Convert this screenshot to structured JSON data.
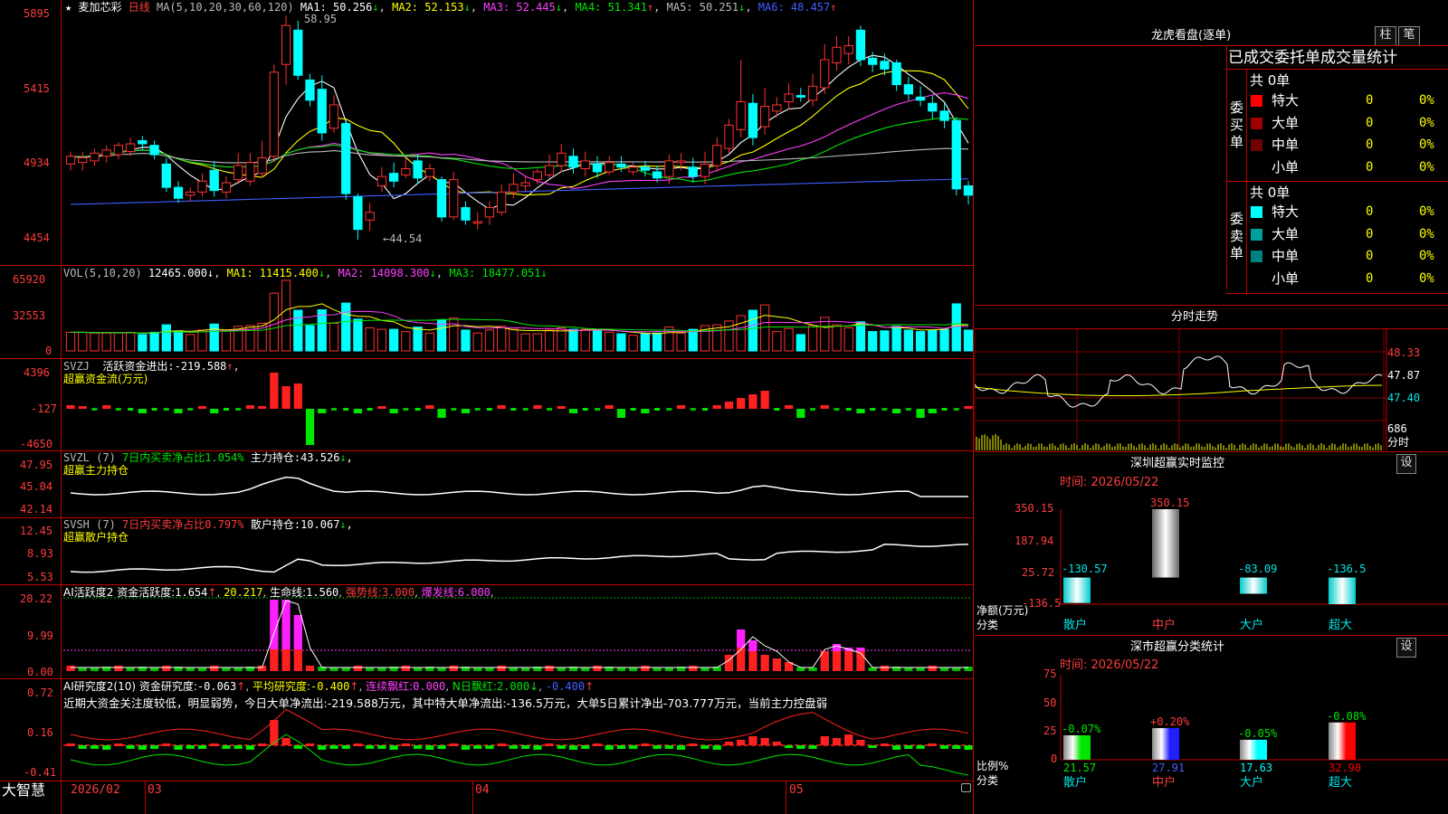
{
  "stock": {
    "star": "★",
    "name": "麦加芯彩",
    "period": "日线"
  },
  "kline": {
    "ma_title": "MA(5,10,20,30,60,120)",
    "ma": [
      {
        "label": "MA1:",
        "value": "50.256",
        "arrow": "↓",
        "color": "#ffffff"
      },
      {
        "label": "MA2:",
        "value": "52.153",
        "arrow": "↓",
        "color": "#ffff00"
      },
      {
        "label": "MA3:",
        "value": "52.445",
        "arrow": "↓",
        "color": "#ff40ff"
      },
      {
        "label": "MA4:",
        "value": "51.341",
        "arrow": "↑",
        "color": "#00e600"
      },
      {
        "label": "MA5:",
        "value": "50.251",
        "arrow": "↓",
        "color": "#bbbbbb"
      },
      {
        "label": "MA6:",
        "value": "48.457",
        "arrow": "↑",
        "color": "#4060ff"
      }
    ],
    "y_ticks": [
      "5895",
      "5415",
      "4934",
      "4454"
    ],
    "high_label": "58.95",
    "low_label": "←44.54"
  },
  "vol": {
    "title": "VOL(5,10,20)",
    "value": "12465.000",
    "value_arrow": "↓",
    "ma": [
      {
        "label": "MA1:",
        "value": "11415.400",
        "arrow": "↓",
        "color": "#ffff00"
      },
      {
        "label": "MA2:",
        "value": "14098.300",
        "arrow": "↓",
        "color": "#ff40ff"
      },
      {
        "label": "MA3:",
        "value": "18477.051",
        "arrow": "↓",
        "color": "#00e600"
      }
    ],
    "y_ticks": [
      "65920",
      "32553",
      "0"
    ]
  },
  "svzj": {
    "title": "SVZJ",
    "label": "活跃资金进出:",
    "value": "-219.588",
    "arrow": "↑",
    "subtitle": "超赢资金流(万元)",
    "y_ticks": [
      "4396",
      "-127",
      "-4650"
    ]
  },
  "svzl": {
    "title": "SVZL (7)",
    "ratio": "7日内买卖净占比1.054%",
    "label": "主力持仓:",
    "value": "43.526",
    "arrow": "↓",
    "sep": ",",
    "subtitle": "超赢主力持仓",
    "y_ticks": [
      "47.95",
      "45.04",
      "42.14"
    ]
  },
  "svsh": {
    "title": "SVSH (7)",
    "ratio": "7日内买卖净占比0.797%",
    "label": "散户持仓:",
    "value": "10.067",
    "arrow": "↓",
    "sep": ",",
    "subtitle": "超赢散户持仓",
    "y_ticks": [
      "12.45",
      "8.93",
      "5.53"
    ]
  },
  "ai_active": {
    "title": "AI活跃度2",
    "label1": "资金活跃度:",
    "value1": "1.654",
    "arrow1": "↑",
    "value2": "20.217",
    "label3": "生命线:",
    "value3": "1.560",
    "label4": "强势线:",
    "value4": "3.000",
    "label5": "爆发线:",
    "value5": "6.000",
    "y_ticks": [
      "20.22",
      "9.99",
      "0.00"
    ]
  },
  "ai_research": {
    "title": "AI研究度2(10)",
    "label1": "资金研究度:",
    "value1": "-0.063",
    "arrow1": "↑",
    "label2": "平均研究度:",
    "value2": "-0.400",
    "arrow2": "↑",
    "label3": "连续飘红:",
    "value3": "0.000",
    "label4": "N日飘红:",
    "value4": "2.000",
    "arrow4": "↓",
    "value5": "-0.400",
    "arrow5": "↑",
    "comment": "近期大资金关注度较低，明显弱势，今日大单净流出:-219.588万元，其中特大单净流出:-136.5万元，大单5日累计净出-703.777万元，当前主力控盘弱",
    "y_ticks": [
      "0.72",
      "0.16",
      "-0.41"
    ]
  },
  "timeline": {
    "brand": "大智慧",
    "labels": [
      "2026/02",
      "03",
      "04",
      "05"
    ]
  },
  "dragon": {
    "title": "龙虎看盘(逐单)",
    "btn1": "柱",
    "btn2": "笔",
    "header": "已成交委托单成交量统计",
    "buy_side": "委买单",
    "sell_side": "委卖单",
    "buy_total": "共 0单",
    "sell_total": "共 0单",
    "buy_rows": [
      {
        "label": "特大",
        "count": "0",
        "pct": "0%",
        "color": "#ff0000"
      },
      {
        "label": "大单",
        "count": "0",
        "pct": "0%",
        "color": "#a00000"
      },
      {
        "label": "中单",
        "count": "0",
        "pct": "0%",
        "color": "#700000"
      },
      {
        "label": "小单",
        "count": "0",
        "pct": "0%",
        "color": ""
      }
    ],
    "sell_rows": [
      {
        "label": "特大",
        "count": "0",
        "pct": "0%",
        "color": "#00ffff"
      },
      {
        "label": "大单",
        "count": "0",
        "pct": "0%",
        "color": "#00a0a0"
      },
      {
        "label": "中单",
        "count": "0",
        "pct": "0%",
        "color": "#008080"
      },
      {
        "label": "小单",
        "count": "0",
        "pct": "0%",
        "color": ""
      }
    ]
  },
  "intraday": {
    "title": "分时走势",
    "prices": [
      "48.33",
      "47.87",
      "47.40"
    ],
    "vol": "686",
    "vol_unit": "分时"
  },
  "sz_monitor": {
    "title": "深圳超赢实时监控",
    "set": "设",
    "time": "时间: 2026/05/22",
    "y_ticks": [
      "350.15",
      "187.94",
      "25.72",
      "-136.5"
    ],
    "ylabel1": "净额(万元)",
    "ylabel2": "分类",
    "categories": [
      "散户",
      "中户",
      "大户",
      "超大"
    ],
    "values": [
      "-130.57",
      "350.15",
      "-83.09",
      "-136.5"
    ]
  },
  "sz_class": {
    "title": "深市超赢分类统计",
    "set": "设",
    "time": "时间: 2026/05/22",
    "y_ticks": [
      "75",
      "50",
      "25",
      "0"
    ],
    "ylabel1": "比例%",
    "ylabel2": "分类",
    "categories": [
      "散户",
      "中户",
      "大户",
      "超大"
    ],
    "changes": [
      "-0.07%",
      "+0.20%",
      "-0.05%",
      "-0.08%"
    ],
    "values": [
      "21.57",
      "27.91",
      "17.63",
      "32.90"
    ],
    "colors": [
      "#00e600",
      "#2020ff",
      "#00ffff",
      "#ff0000"
    ]
  },
  "chart_data": [
    {
      "type": "candlestick",
      "title": "麦加芯彩 日线",
      "ylim": [
        44.54,
        58.95
      ],
      "x_labels": [
        "2026/02",
        "03",
        "04",
        "05"
      ],
      "candles": [
        [
          49.4,
          49.9,
          49.0,
          50.2
        ],
        [
          49.5,
          49.8,
          49.0,
          50.2
        ],
        [
          49.6,
          50.1,
          49.3,
          50.4
        ],
        [
          49.9,
          50.3,
          49.5,
          50.6
        ],
        [
          50.0,
          50.6,
          49.7,
          50.8
        ],
        [
          50.2,
          50.7,
          49.9,
          51.1
        ],
        [
          50.9,
          50.7,
          50.3,
          51.2
        ],
        [
          50.6,
          50.0,
          49.7,
          50.9
        ],
        [
          49.4,
          47.9,
          47.6,
          49.8
        ],
        [
          47.9,
          47.2,
          46.9,
          48.3
        ],
        [
          47.4,
          47.6,
          47.0,
          47.9
        ],
        [
          47.6,
          48.3,
          47.3,
          48.8
        ],
        [
          49.0,
          47.7,
          47.3,
          49.6
        ],
        [
          47.6,
          48.2,
          47.2,
          48.6
        ],
        [
          48.4,
          49.3,
          48.1,
          50.1
        ],
        [
          48.3,
          49.5,
          48.0,
          50.1
        ],
        [
          48.8,
          49.8,
          48.5,
          50.9
        ],
        [
          49.9,
          55.3,
          49.5,
          55.8
        ],
        [
          55.8,
          58.3,
          54.5,
          58.95
        ],
        [
          58.0,
          55.1,
          54.8,
          58.6
        ],
        [
          54.8,
          53.5,
          53.1,
          55.2
        ],
        [
          54.2,
          51.4,
          50.9,
          55.1
        ],
        [
          51.7,
          53.2,
          51.4,
          53.8
        ],
        [
          52.0,
          47.5,
          47.1,
          52.2
        ],
        [
          47.3,
          45.2,
          44.54,
          47.5
        ],
        [
          45.8,
          46.3,
          45.1,
          46.9
        ],
        [
          48.0,
          48.6,
          47.6,
          49.2
        ],
        [
          48.8,
          48.3,
          47.9,
          49.5
        ],
        [
          48.7,
          49.1,
          48.5,
          49.8
        ],
        [
          49.6,
          48.5,
          48.1,
          50.0
        ],
        [
          48.6,
          49.1,
          48.3,
          49.4
        ],
        [
          48.4,
          46.0,
          45.7,
          48.6
        ],
        [
          46.0,
          48.4,
          45.8,
          48.9
        ],
        [
          46.6,
          45.8,
          45.5,
          47.0
        ],
        [
          45.6,
          45.7,
          45.2,
          46.3
        ],
        [
          46.0,
          46.6,
          45.5,
          47.0
        ],
        [
          46.3,
          47.6,
          46.1,
          48.1
        ],
        [
          47.6,
          48.1,
          47.2,
          48.8
        ],
        [
          48.0,
          48.2,
          47.6,
          48.6
        ],
        [
          48.4,
          48.9,
          48.1,
          49.1
        ],
        [
          48.7,
          49.3,
          48.5,
          50.0
        ],
        [
          49.3,
          50.1,
          48.9,
          50.7
        ],
        [
          49.9,
          49.2,
          48.8,
          50.4
        ],
        [
          49.1,
          49.6,
          48.6,
          50.2
        ],
        [
          49.4,
          48.9,
          48.5,
          49.9
        ],
        [
          48.9,
          49.5,
          48.7,
          49.9
        ],
        [
          49.4,
          49.2,
          48.9,
          49.9
        ],
        [
          48.9,
          49.2,
          48.7,
          49.5
        ],
        [
          49.2,
          49.0,
          48.6,
          49.6
        ],
        [
          48.9,
          48.5,
          48.2,
          49.3
        ],
        [
          48.6,
          49.6,
          48.1,
          50.0
        ],
        [
          49.5,
          49.6,
          49.0,
          50.1
        ],
        [
          49.2,
          48.6,
          48.2,
          49.8
        ],
        [
          48.6,
          49.4,
          48.1,
          50.2
        ],
        [
          49.3,
          50.6,
          48.9,
          51.1
        ],
        [
          50.4,
          51.9,
          50.1,
          52.3
        ],
        [
          51.6,
          53.4,
          51.1,
          56.1
        ],
        [
          53.3,
          51.1,
          50.6,
          53.9
        ],
        [
          51.8,
          53.1,
          51.3,
          54.3
        ],
        [
          52.8,
          53.2,
          52.4,
          53.7
        ],
        [
          53.4,
          53.9,
          52.9,
          54.6
        ],
        [
          53.8,
          53.7,
          53.4,
          54.3
        ],
        [
          53.5,
          54.4,
          53.1,
          55.2
        ],
        [
          54.3,
          56.1,
          53.9,
          57.1
        ],
        [
          55.9,
          56.9,
          55.4,
          57.6
        ],
        [
          56.5,
          57.0,
          55.8,
          57.6
        ],
        [
          58.0,
          56.1,
          55.7,
          58.3
        ],
        [
          56.2,
          55.8,
          55.3,
          56.6
        ],
        [
          56.0,
          55.5,
          55.1,
          56.5
        ],
        [
          55.9,
          54.5,
          54.1,
          56.1
        ],
        [
          54.5,
          53.9,
          53.5,
          55.0
        ],
        [
          53.7,
          53.5,
          53.1,
          54.4
        ],
        [
          53.3,
          52.8,
          52.3,
          53.8
        ],
        [
          52.8,
          52.2,
          51.7,
          53.3
        ],
        [
          52.2,
          47.8,
          47.4,
          52.4
        ],
        [
          48.0,
          47.4,
          46.8,
          48.3
        ]
      ],
      "volume_max": 65920
    }
  ]
}
